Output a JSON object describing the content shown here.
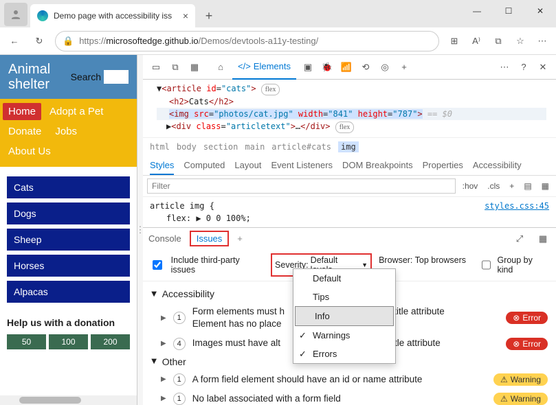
{
  "browser": {
    "tab_title": "Demo page with accessibility iss",
    "url_prefix": "https://",
    "url_host": "microsoftedge.github.io",
    "url_path": "/Demos/devtools-a11y-testing/"
  },
  "page": {
    "site_title_1": "Animal",
    "site_title_2": "shelter",
    "search_label": "Search",
    "nav": {
      "home": "Home",
      "adopt": "Adopt a Pet",
      "donate": "Donate",
      "jobs": "Jobs",
      "about": "About Us"
    },
    "cats": [
      "Cats",
      "Dogs",
      "Sheep",
      "Horses",
      "Alpacas"
    ],
    "help_heading": "Help us with a donation",
    "donations": [
      "50",
      "100",
      "200"
    ]
  },
  "devtools": {
    "elements_label": "Elements",
    "dom": {
      "article_open": "<article id=\"cats\">",
      "h2": "Cats",
      "img_src": "photos/cat.jpg",
      "img_w": "841",
      "img_h": "787",
      "eq0": "== $0",
      "div_class": "articletext",
      "flex_badge": "flex"
    },
    "crumbs": [
      "html",
      "body",
      "section",
      "main",
      "article#cats",
      "img"
    ],
    "style_tabs": [
      "Styles",
      "Computed",
      "Layout",
      "Event Listeners",
      "DOM Breakpoints",
      "Properties",
      "Accessibility"
    ],
    "filter_placeholder": "Filter",
    "hov": ":hov",
    "cls": ".cls",
    "css_selector": "article img {",
    "css_rule": "flex: ▶ 0 0 100%;",
    "css_link": "styles.css:45",
    "drawer": {
      "console": "Console",
      "issues": "Issues"
    },
    "issues_bar": {
      "include_tp": "Include third-party issues",
      "severity_label": "Severity:",
      "severity_value": "Default levels",
      "browser_label": "Browser:",
      "browser_value": "Top browsers",
      "group_label": "Group by kind"
    },
    "sev_menu": [
      "Default",
      "Tips",
      "Info",
      "Warnings",
      "Errors"
    ],
    "issues": {
      "cat_a11y": "Accessibility",
      "cat_other": "Other",
      "a11y_1_count": "1",
      "a11y_1_line1": "Form elements must h",
      "a11y_1_line1_tail": "o title attribute",
      "a11y_1_line2": "Element has no place",
      "a11y_2_count": "4",
      "a11y_2_text": "Images must have alt",
      "a11y_2_tail": "o title attribute",
      "other_1_count": "1",
      "other_1_text": "A form field element should have an id or name attribute",
      "other_2_count": "1",
      "other_2_text": "No label associated with a form field",
      "error_label": "Error",
      "warning_label": "Warning"
    }
  }
}
